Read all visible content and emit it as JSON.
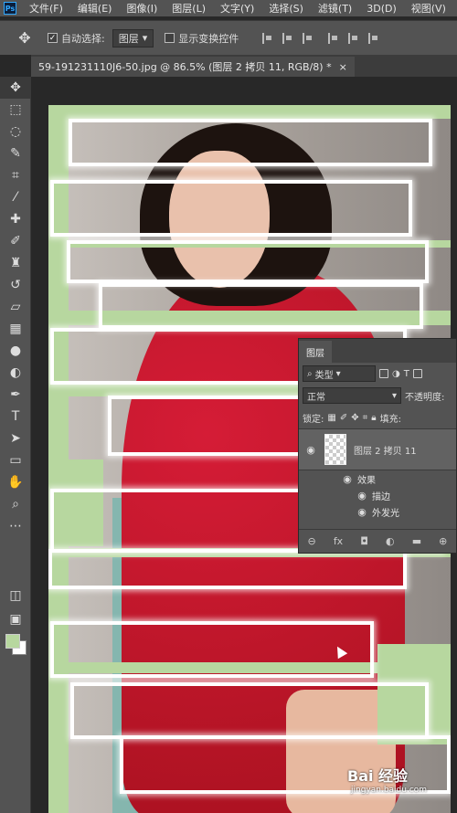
{
  "menubar": {
    "logo": "Ps",
    "items": [
      "文件(F)",
      "编辑(E)",
      "图像(I)",
      "图层(L)",
      "文字(Y)",
      "选择(S)",
      "滤镜(T)",
      "3D(D)",
      "视图(V)"
    ]
  },
  "options": {
    "auto_select_label": "自动选择:",
    "auto_select_value": "图层",
    "show_transform_label": "显示变换控件"
  },
  "document": {
    "tab_title": "59-191231110J6-50.jpg @ 86.5% (图层 2 拷贝 11, RGB/8) *",
    "close_glyph": "×"
  },
  "colors": {
    "foreground": "#b7d79f",
    "background": "#ffffff",
    "accent": "#31a8ff"
  },
  "layers_panel": {
    "tab": "图层",
    "filter_kind": "类型",
    "blend_mode": "正常",
    "opacity_label": "不透明度:",
    "lock_label": "锁定:",
    "fill_label": "填充:",
    "layer_name": "图层 2 拷贝 11",
    "effects_label": "效果",
    "effect_1": "描边",
    "effect_2": "外发光"
  },
  "watermark": {
    "brand": "Bai 经验",
    "url": "jingyan.baidu.com"
  }
}
